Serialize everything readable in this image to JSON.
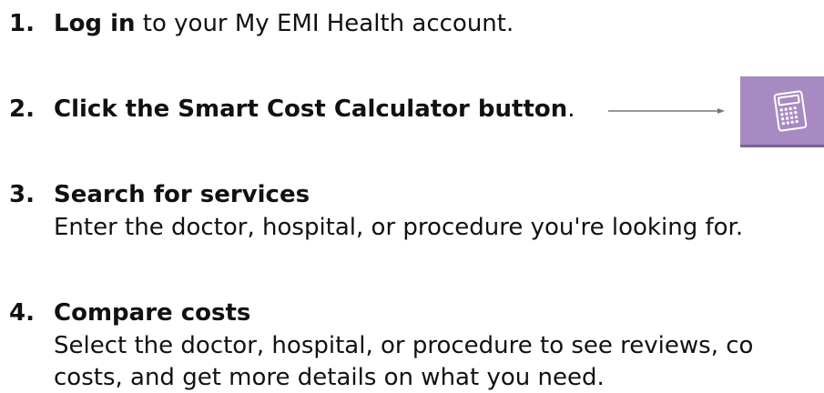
{
  "steps": [
    {
      "number": "1.",
      "bold": "Log in",
      "rest": " to your My EMI Health account."
    },
    {
      "number": "2.",
      "bold": "Click the Smart Cost Calculator button",
      "rest": "."
    },
    {
      "number": "3.",
      "title": "Search for services",
      "description": "Enter the doctor, hospital, or procedure you're looking for."
    },
    {
      "number": "4.",
      "title": "Compare costs",
      "description_line1": "Select the doctor, hospital, or procedure to see reviews, co",
      "description_line2": "costs, and get more details on what you need."
    }
  ],
  "calculator_button": {
    "icon": "calculator-icon",
    "color": "#a78ac2"
  },
  "arrow_color": "#777777"
}
